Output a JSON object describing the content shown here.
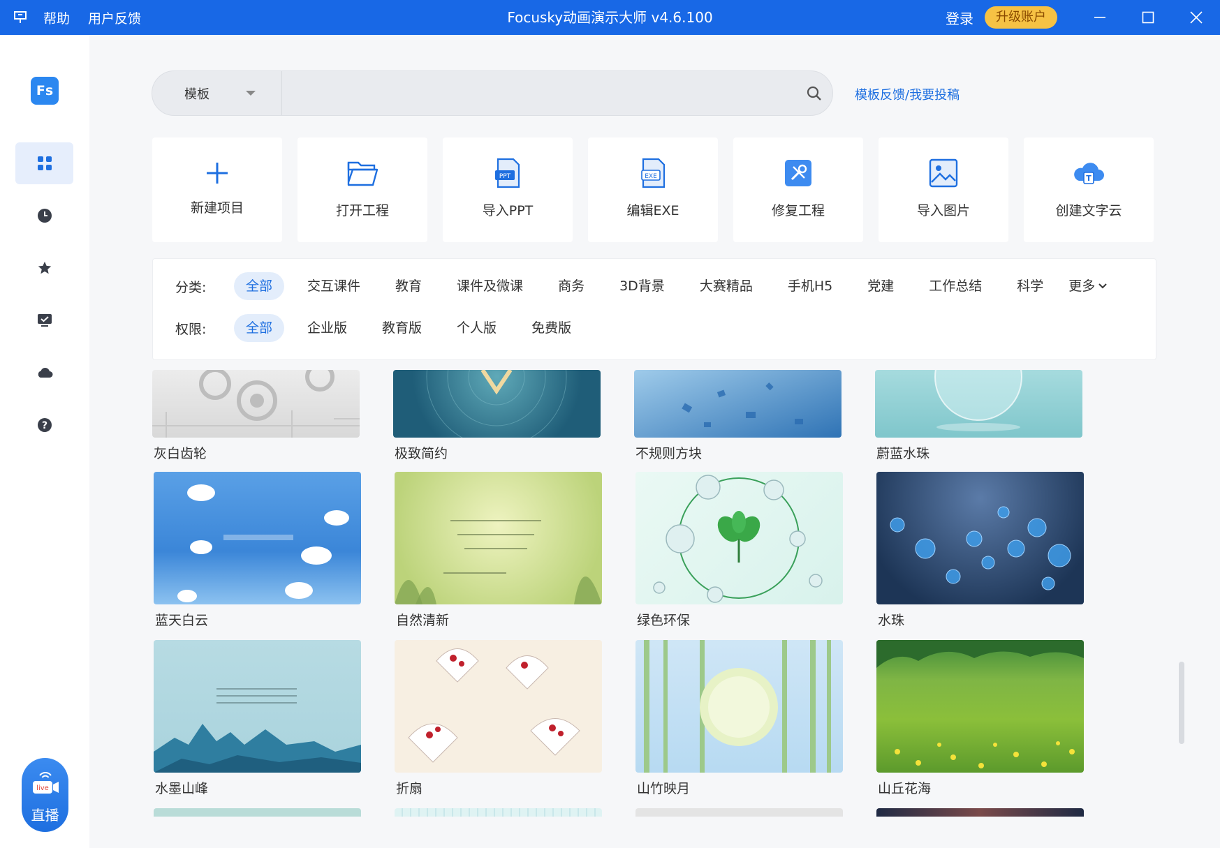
{
  "titlebar": {
    "title": "Focusky动画演示大师 v4.6.100",
    "help": "帮助",
    "feedback": "用户反馈",
    "login": "登录",
    "upgrade": "升级账户"
  },
  "sidebar": {
    "logo": "Fs",
    "items": [
      {
        "icon": "grid-icon",
        "active": true
      },
      {
        "icon": "clock-icon"
      },
      {
        "icon": "star-icon"
      },
      {
        "icon": "presentation-check-icon"
      },
      {
        "icon": "cloud-icon"
      },
      {
        "icon": "help-icon"
      }
    ],
    "live_badge": "live",
    "live_label": "直播"
  },
  "search": {
    "type_label": "模板",
    "placeholder": "",
    "feedback_link": "模板反馈/我要投稿"
  },
  "actions": [
    {
      "label": "新建项目",
      "icon": "plus-icon"
    },
    {
      "label": "打开工程",
      "icon": "folder-icon"
    },
    {
      "label": "导入PPT",
      "icon": "ppt-file-icon",
      "badge": "PPT"
    },
    {
      "label": "编辑EXE",
      "icon": "exe-file-icon",
      "badge": "EXE"
    },
    {
      "label": "修复工程",
      "icon": "repair-tools-icon"
    },
    {
      "label": "导入图片",
      "icon": "image-icon"
    },
    {
      "label": "创建文字云",
      "icon": "text-cloud-icon"
    }
  ],
  "filters": {
    "category_label": "分类:",
    "categories": [
      "全部",
      "交互课件",
      "教育",
      "课件及微课",
      "商务",
      "3D背景",
      "大赛精品",
      "手机H5",
      "党建",
      "工作总结",
      "科学"
    ],
    "more": "更多",
    "permission_label": "权限:",
    "permissions": [
      "全部",
      "企业版",
      "教育版",
      "个人版",
      "免费版"
    ]
  },
  "templates": [
    {
      "name": "灰白齿轮"
    },
    {
      "name": "极致简约"
    },
    {
      "name": "不规则方块"
    },
    {
      "name": "蔚蓝水珠"
    },
    {
      "name": "蓝天白云"
    },
    {
      "name": "自然清新"
    },
    {
      "name": "绿色环保"
    },
    {
      "name": "水珠"
    },
    {
      "name": "水墨山峰"
    },
    {
      "name": "折扇"
    },
    {
      "name": "山竹映月"
    },
    {
      "name": "山丘花海"
    }
  ],
  "colors": {
    "accent": "#1868e6",
    "upgrade": "#f6c244",
    "chip_active_bg": "#e3edfb"
  }
}
